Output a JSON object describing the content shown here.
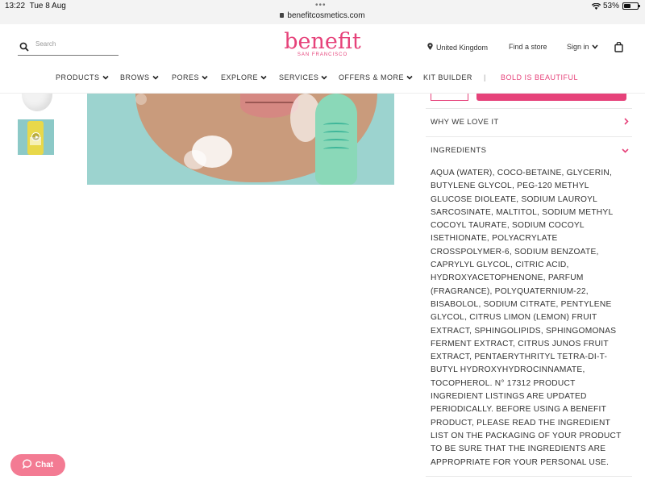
{
  "statusbar": {
    "time": "13:22",
    "date": "Tue 8 Aug",
    "url": "benefitcosmetics.com",
    "battery": "53%",
    "battery_level": 0.53,
    "dots": "•••"
  },
  "header": {
    "search_placeholder": "Search",
    "logo": "benefit",
    "logo_sub": "SAN FRANCISCO",
    "location": "United Kingdom",
    "find_store": "Find a store",
    "sign_in": "Sign in"
  },
  "nav": {
    "items": [
      {
        "label": "PRODUCTS"
      },
      {
        "label": "BROWS"
      },
      {
        "label": "PORES"
      },
      {
        "label": "EXPLORE"
      },
      {
        "label": "SERVICES"
      },
      {
        "label": "OFFERS & MORE"
      },
      {
        "label": "KIT BUILDER"
      }
    ],
    "separator": "|",
    "highlight": "BOLD IS BEAUTIFUL",
    "highlight_color": "#e6427a"
  },
  "accordion": {
    "why_we_love_it": "WHY WE LOVE IT",
    "ingredients": "INGREDIENTS",
    "ingredients_text": "AQUA (WATER), COCO-BETAINE, GLYCERIN, BUTYLENE GLYCOL, PEG-120 METHYL GLUCOSE DIOLEATE, SODIUM LAUROYL SARCOSINATE, MALTITOL, SODIUM METHYL COCOYL TAURATE, SODIUM COCOYL ISETHIONATE, POLYACRYLATE CROSSPOLYMER-6, SODIUM BENZOATE, CAPRYLYL GLYCOL, CITRIC ACID, HYDROXYACETOPHENONE, PARFUM (FRAGRANCE), POLYQUATERNIUM-22, BISABOLOL, SODIUM CITRATE, PENTYLENE GLYCOL, CITRUS LIMON (LEMON) FRUIT EXTRACT, SPHINGOLIPIDS, SPHINGOMONAS FERMENT EXTRACT, CITRUS JUNOS FRUIT EXTRACT, PENTAERYTHRITYL TETRA-DI-T-BUTYL HYDROXYHYDROCINNAMATE, TOCOPHEROL. N° 17312 PRODUCT INGREDIENT LISTINGS ARE UPDATED PERIODICALLY. BEFORE USING A BENEFIT PRODUCT, PLEASE READ THE INGREDIENT LIST ON THE PACKAGING OF YOUR PRODUCT TO BE SURE THAT THE INGREDIENTS ARE APPROPRIATE FOR YOUR PERSONAL USE."
  },
  "chat": {
    "label": "Chat"
  },
  "colors": {
    "brand_pink": "#e6427a",
    "chat_pink": "#f37b93",
    "hero_bg": "#9cd3cf"
  },
  "icons": {
    "search": "search-icon",
    "location": "location-pin-icon",
    "bag": "shopping-bag-icon",
    "chevron": "chevron-down-icon",
    "chat": "chat-bubble-icon",
    "play": "play-icon"
  }
}
